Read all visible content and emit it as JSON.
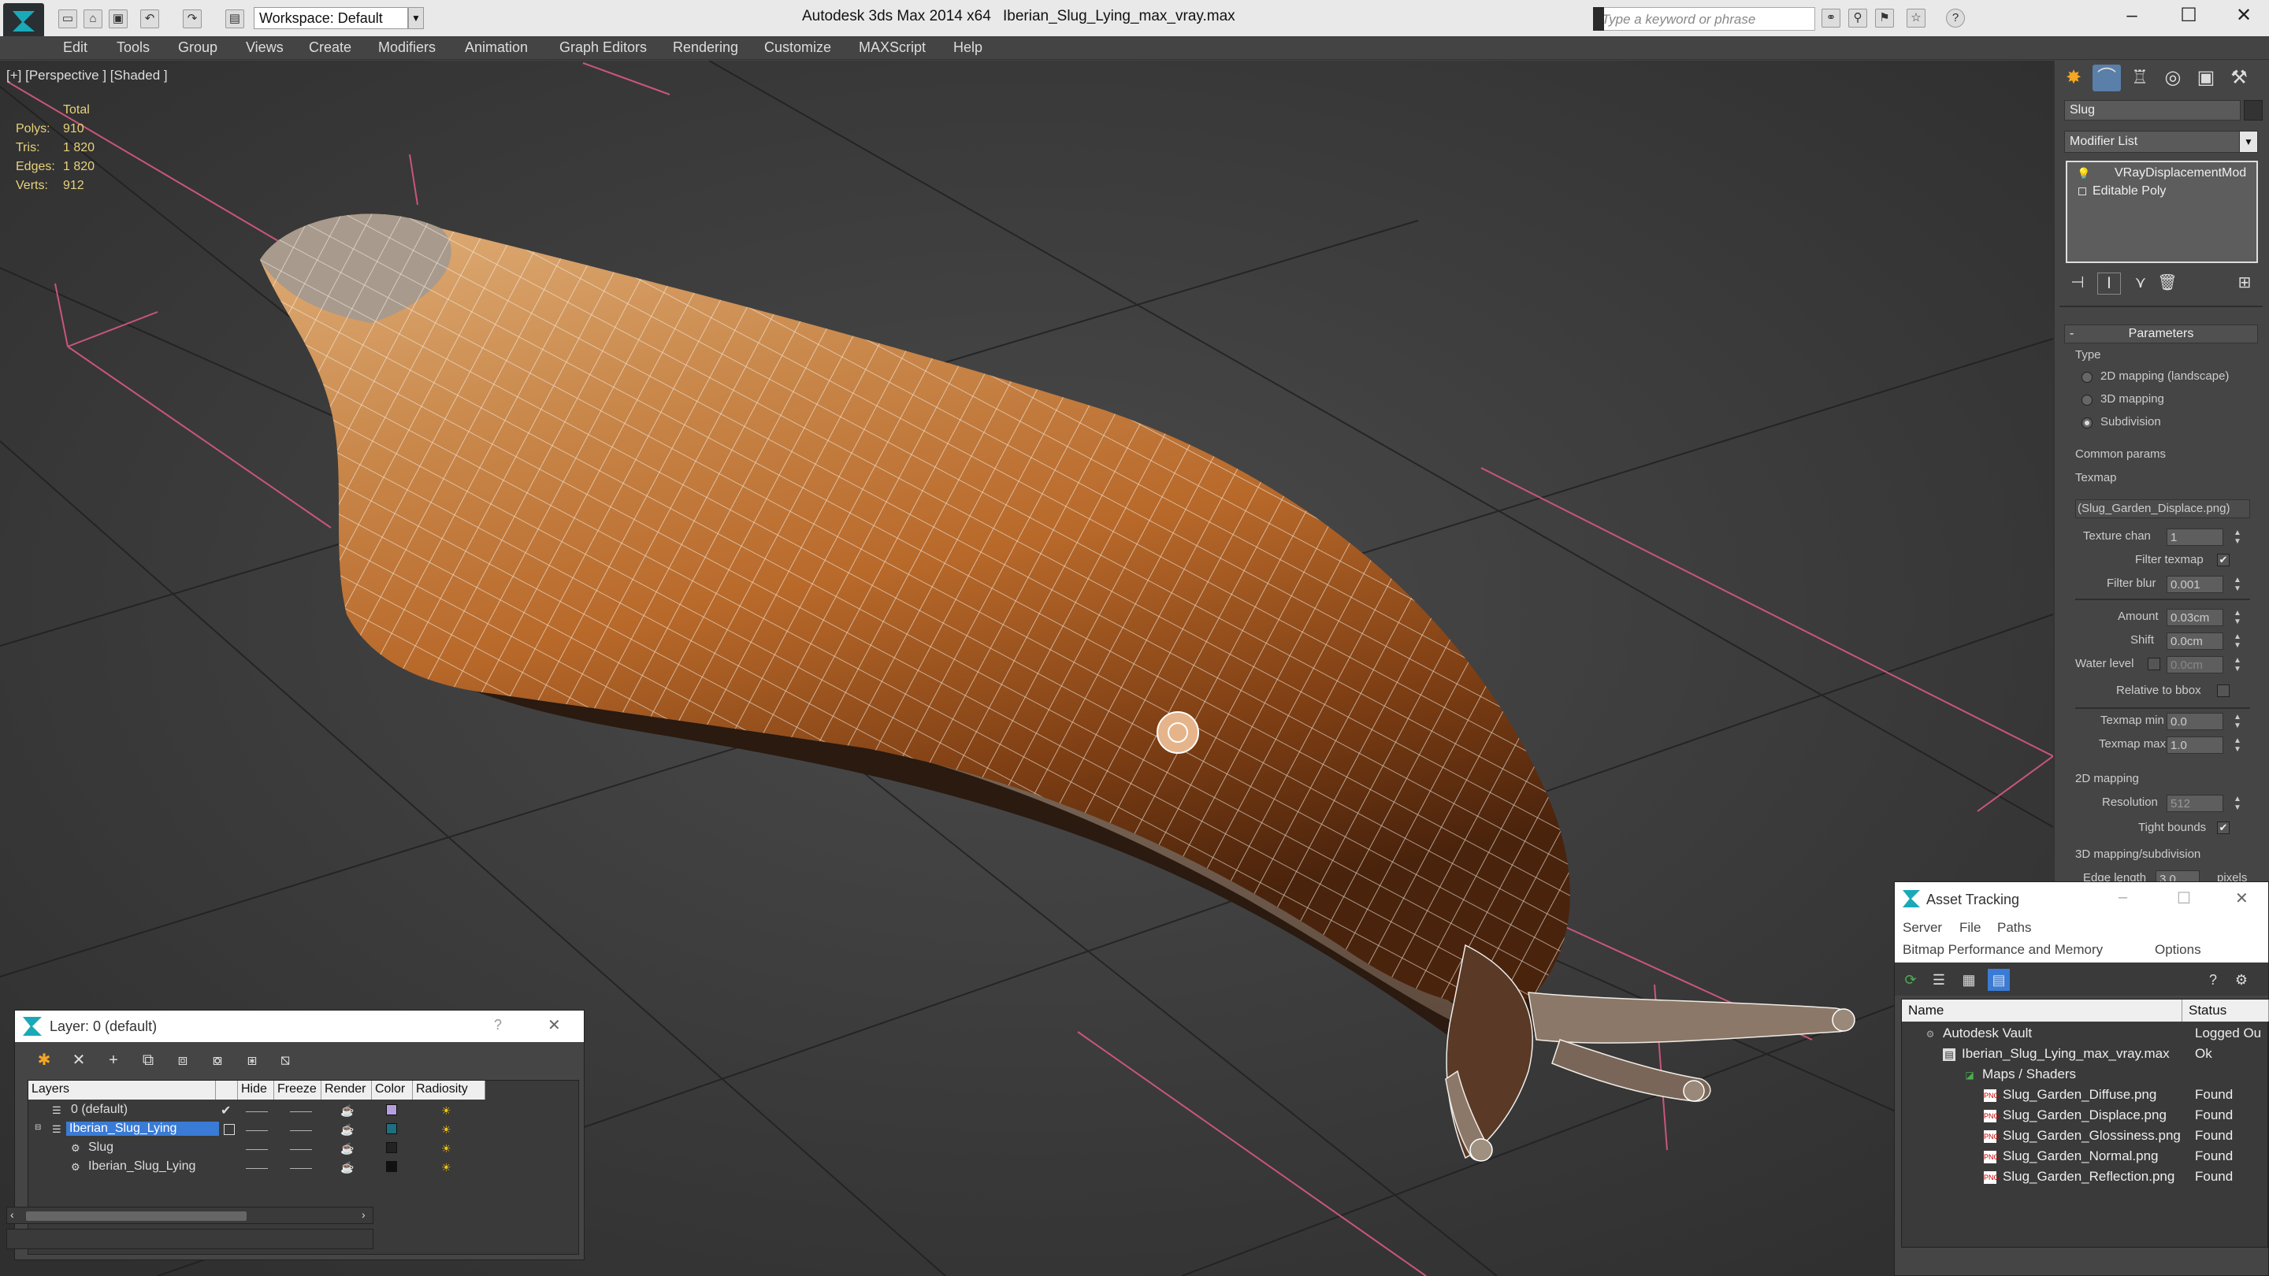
{
  "titlebar": {
    "workspace": "Workspace: Default",
    "app_title": "Autodesk 3ds Max  2014 x64",
    "file_title": "Iberian_Slug_Lying_max_vray.max",
    "search_placeholder": "Type a keyword or phrase",
    "minimize": "–",
    "maximize": "☐",
    "close": "✕"
  },
  "menu": [
    "Edit",
    "Tools",
    "Group",
    "Views",
    "Create",
    "Modifiers",
    "Animation",
    "Graph Editors",
    "Rendering",
    "Customize",
    "MAXScript",
    "Help"
  ],
  "viewport": {
    "label": "[+] [Perspective ] [Shaded ]",
    "stats_header": "Total",
    "stats": [
      {
        "label": "Polys:",
        "value": "910"
      },
      {
        "label": "Tris:",
        "value": "1 820"
      },
      {
        "label": "Edges:",
        "value": "1 820"
      },
      {
        "label": "Verts:",
        "value": "912"
      }
    ]
  },
  "command_panel": {
    "object_name": "Slug",
    "modifier_list": "Modifier List",
    "stack": [
      "VRayDisplacementMod",
      "Editable Poly"
    ],
    "rollout_title": "Parameters",
    "rollout_collapse": "-",
    "type_group": "Type",
    "type_options": [
      "2D mapping (landscape)",
      "3D mapping",
      "Subdivision"
    ],
    "type_selected": 2,
    "common_group": "Common params",
    "texmap_label": "Texmap",
    "texmap_value": "(Slug_Garden_Displace.png)",
    "texture_chan_label": "Texture chan",
    "texture_chan_value": "1",
    "filter_texmap_label": "Filter texmap",
    "filter_texmap_checked": "✔",
    "filter_blur_label": "Filter blur",
    "filter_blur_value": "0.001",
    "amount_label": "Amount",
    "amount_value": "0.03cm",
    "shift_label": "Shift",
    "shift_value": "0.0cm",
    "water_level_label": "Water level",
    "water_level_value": "0.0cm",
    "relative_bbox_label": "Relative to bbox",
    "texmap_min_label": "Texmap min",
    "texmap_min_value": "0.0",
    "texmap_max_label": "Texmap max",
    "texmap_max_value": "1.0",
    "mapping2d_group": "2D mapping",
    "resolution_label": "Resolution",
    "resolution_value": "512",
    "tight_bounds_label": "Tight bounds",
    "tight_bounds_checked": "✔",
    "mapping3d_group": "3D mapping/subdivision",
    "edge_length_label": "Edge length",
    "edge_length_value": "3.0",
    "edge_length_unit": "pixels"
  },
  "layer_dialog": {
    "title": "Layer: 0 (default)",
    "help": "?",
    "close": "✕",
    "columns": [
      "Layers",
      "Hide",
      "Freeze",
      "Render",
      "Color",
      "Radiosity"
    ],
    "rows": [
      {
        "name": "0 (default)",
        "current": "✔",
        "indent": 1,
        "color": "#b59fe0"
      },
      {
        "name": "Iberian_Slug_Lying",
        "current": "",
        "indent": 1,
        "color": "#1e6f80",
        "selected": true
      },
      {
        "name": "Slug",
        "current": "",
        "indent": 2,
        "color": "#222222"
      },
      {
        "name": "Iberian_Slug_Lying",
        "current": "",
        "indent": 2,
        "color": "#111111"
      }
    ],
    "dash": "——"
  },
  "asset_dialog": {
    "title": "Asset Tracking",
    "menu_row1": [
      "Server",
      "File",
      "Paths"
    ],
    "menu_row2": [
      "Bitmap Performance and Memory",
      "Options"
    ],
    "columns": [
      "Name",
      "Status"
    ],
    "rows": [
      {
        "name": "Autodesk Vault",
        "status": "Logged Ou",
        "indent": 1,
        "icon": "vault-icon"
      },
      {
        "name": "Iberian_Slug_Lying_max_vray.max",
        "status": "Ok",
        "indent": 2,
        "icon": "max-file-icon"
      },
      {
        "name": "Maps / Shaders",
        "status": "",
        "indent": 3,
        "icon": "maps-icon"
      },
      {
        "name": "Slug_Garden_Diffuse.png",
        "status": "Found",
        "indent": 4,
        "icon": "png-icon"
      },
      {
        "name": "Slug_Garden_Displace.png",
        "status": "Found",
        "indent": 4,
        "icon": "png-icon"
      },
      {
        "name": "Slug_Garden_Glossiness.png",
        "status": "Found",
        "indent": 4,
        "icon": "png-icon"
      },
      {
        "name": "Slug_Garden_Normal.png",
        "status": "Found",
        "indent": 4,
        "icon": "png-icon"
      },
      {
        "name": "Slug_Garden_Reflection.png",
        "status": "Found",
        "indent": 4,
        "icon": "png-icon"
      }
    ]
  },
  "colors": {
    "viewport_bg": "#3b3b3b",
    "stats": "#e7d27a",
    "grid_axis": "#c9567a",
    "slug_dark": "#7a3d12",
    "slug_light": "#d9a36a",
    "wire": "#ffffff",
    "selection": "#3a7bd5"
  }
}
